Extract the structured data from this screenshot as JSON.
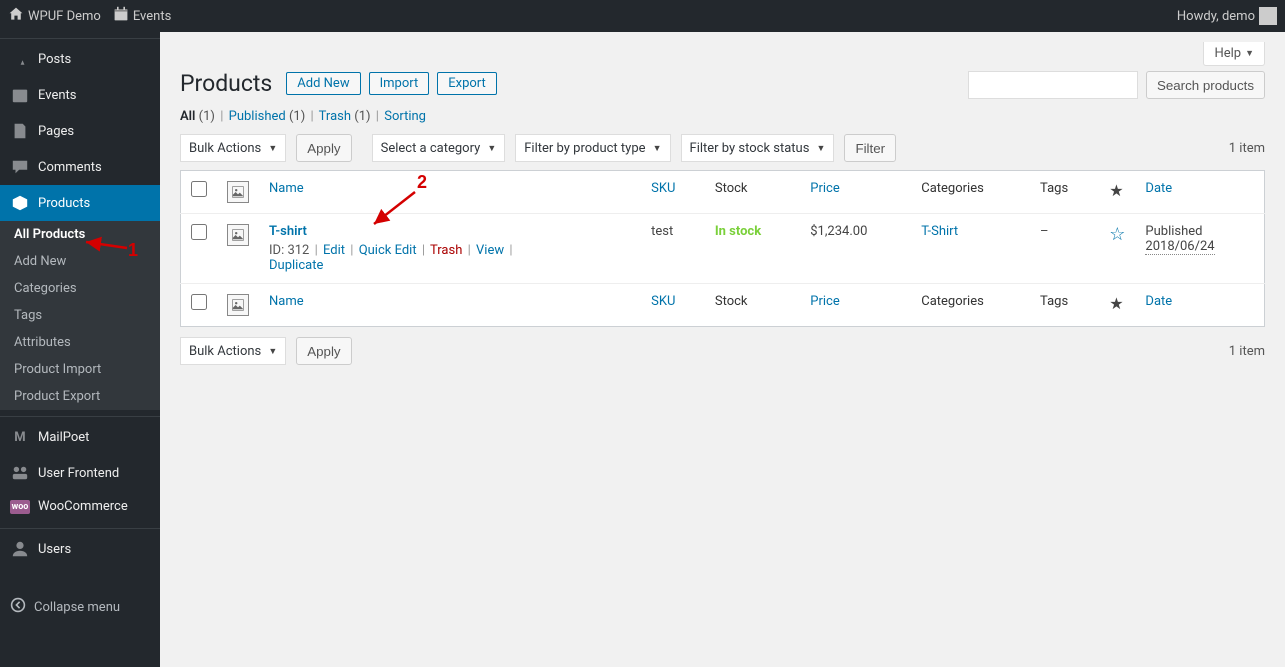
{
  "toolbar": {
    "site_name": "WPUF Demo",
    "events": "Events",
    "howdy": "Howdy, demo"
  },
  "sidebar": {
    "items": [
      {
        "icon": "pin",
        "label": "Posts"
      },
      {
        "icon": "cal",
        "label": "Events"
      },
      {
        "icon": "page",
        "label": "Pages"
      },
      {
        "icon": "comment",
        "label": "Comments"
      },
      {
        "icon": "box",
        "label": "Products"
      },
      {
        "icon": "m",
        "label": "MailPoet"
      },
      {
        "icon": "uf",
        "label": "User Frontend"
      },
      {
        "icon": "woo",
        "label": "WooCommerce"
      },
      {
        "icon": "user",
        "label": "Users"
      }
    ],
    "products_submenu": [
      "All Products",
      "Add New",
      "Categories",
      "Tags",
      "Attributes",
      "Product Import",
      "Product Export"
    ],
    "collapse": "Collapse menu"
  },
  "page": {
    "title": "Products",
    "add_new": "Add New",
    "import": "Import",
    "export": "Export",
    "help": "Help",
    "search_btn": "Search products",
    "item_count": "1 item"
  },
  "views": {
    "all": "All",
    "all_count": "(1)",
    "published": "Published",
    "published_count": "(1)",
    "trash": "Trash",
    "trash_count": "(1)",
    "sorting": "Sorting"
  },
  "filters": {
    "bulk": "Bulk Actions",
    "apply": "Apply",
    "category": "Select a category",
    "ptype": "Filter by product type",
    "stock": "Filter by stock status",
    "filter_btn": "Filter"
  },
  "table": {
    "cols": {
      "name": "Name",
      "sku": "SKU",
      "stock": "Stock",
      "price": "Price",
      "categories": "Categories",
      "tags": "Tags",
      "date": "Date"
    },
    "rows": [
      {
        "name": "T-shirt",
        "id": "ID: 312",
        "edit": "Edit",
        "quick_edit": "Quick Edit",
        "trash": "Trash",
        "view": "View",
        "duplicate": "Duplicate",
        "sku": "test",
        "stock": "In stock",
        "price": "$1,234.00",
        "category": "T-Shirt",
        "tags": "–",
        "date_status": "Published",
        "date": "2018/06/24"
      }
    ]
  },
  "annotations": {
    "n1": "1",
    "n2": "2"
  }
}
